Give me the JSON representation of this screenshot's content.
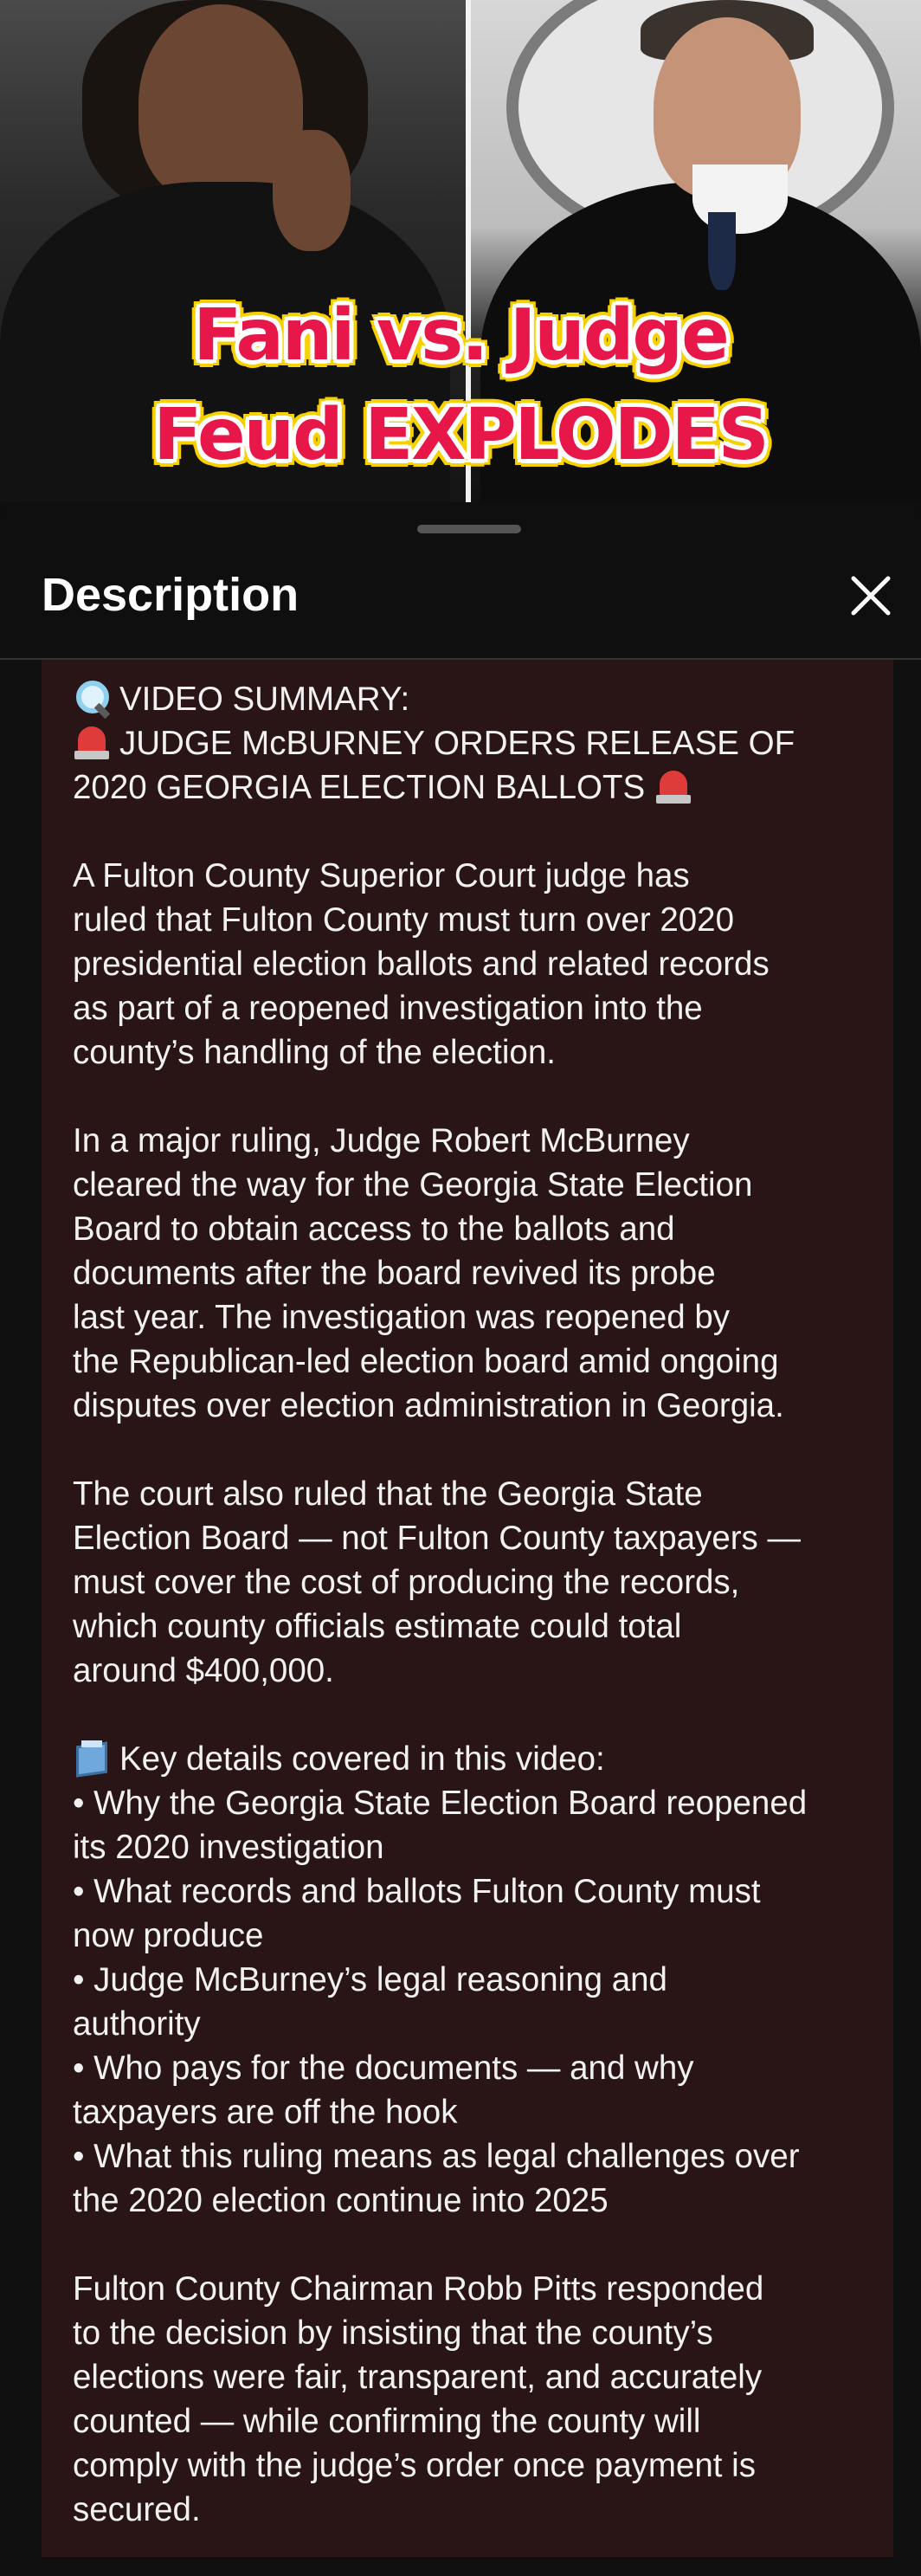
{
  "thumbnail": {
    "title_line1": "Fani vs. Judge",
    "title_line2": "Feud EXPLODES",
    "title_color": "#e8174a",
    "outline_color": "#f7d000"
  },
  "sheet": {
    "title": "Description",
    "close_icon": "close-icon"
  },
  "description": {
    "summary_header": "VIDEO SUMMARY:",
    "headline_line1": "JUDGE McBURNEY ORDERS RELEASE OF",
    "headline_line2": "2020 GEORGIA ELECTION BALLOTS",
    "para1": [
      "A Fulton County Superior Court judge has",
      "ruled that Fulton County must turn over 2020",
      "presidential election ballots and related records",
      "as part of a reopened investigation into the",
      "county’s handling of the election."
    ],
    "para2": [
      "In a major ruling, Judge Robert McBurney",
      "cleared the way for the Georgia State Election",
      "Board to obtain access to the ballots and",
      "documents after the board revived its probe",
      "last year. The investigation was reopened by",
      "the Republican-led election board amid ongoing",
      "disputes over election administration in Georgia."
    ],
    "para3": [
      "The court also ruled that the Georgia State",
      "Election Board — not Fulton County taxpayers —",
      "must cover the cost of producing the records,",
      "which county officials estimate could total",
      "around $400,000."
    ],
    "key_header": "Key details covered in this video:",
    "bullets": [
      "• Why the Georgia State Election Board reopened",
      "its 2020 investigation",
      "• What records and ballots Fulton County must",
      "now produce",
      "• Judge McBurney’s legal reasoning and",
      "authority",
      "• Who pays for the documents — and why",
      "taxpayers are off the hook",
      "• What this ruling means as legal challenges over",
      "the 2020 election continue into 2025"
    ],
    "para4": [
      "Fulton County Chairman Robb Pitts responded",
      "to the decision by insisting that the county’s",
      "elections were fair, transparent, and accurately",
      "counted — while confirming the county will",
      "comply with the judge’s order once payment is",
      "secured."
    ],
    "icons": [
      "magnifying-glass-icon",
      "siren-icon",
      "ballot-box-icon"
    ]
  }
}
